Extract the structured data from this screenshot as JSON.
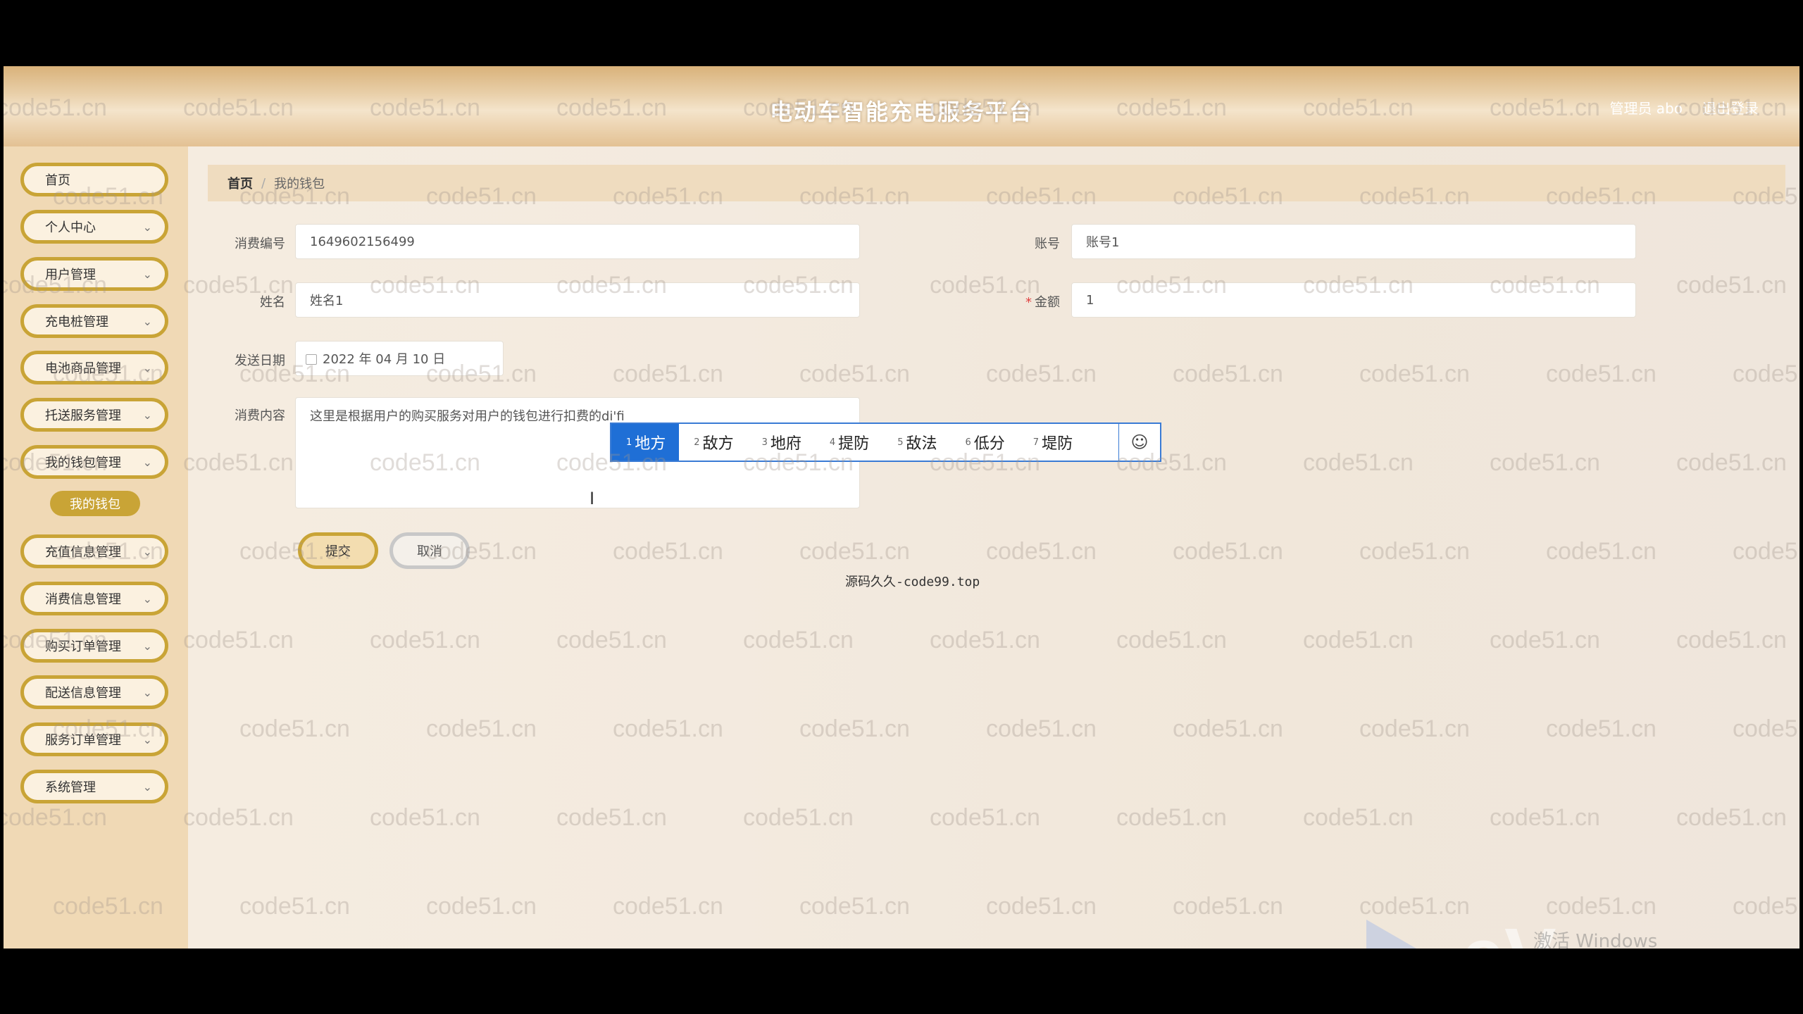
{
  "header": {
    "title": "电动车智能充电服务平台",
    "admin_label": "管理员 abo",
    "logout_label": "退出登录"
  },
  "sidebar": {
    "items": [
      {
        "label": "首页",
        "chevron": false
      },
      {
        "label": "个人中心",
        "chevron": true
      },
      {
        "label": "用户管理",
        "chevron": true
      },
      {
        "label": "充电桩管理",
        "chevron": true
      },
      {
        "label": "电池商品管理",
        "chevron": true
      },
      {
        "label": "托送服务管理",
        "chevron": true
      },
      {
        "label": "我的钱包管理",
        "chevron": true
      },
      {
        "label": "充值信息管理",
        "chevron": true
      },
      {
        "label": "消费信息管理",
        "chevron": true
      },
      {
        "label": "购买订单管理",
        "chevron": true
      },
      {
        "label": "配送信息管理",
        "chevron": true
      },
      {
        "label": "服务订单管理",
        "chevron": true
      },
      {
        "label": "系统管理",
        "chevron": true
      }
    ],
    "sub_item_label": "我的钱包"
  },
  "breadcrumb": {
    "home": "首页",
    "separator": "/",
    "current": "我的钱包"
  },
  "form": {
    "consume_no_label": "消费编号",
    "consume_no_value": "1649602156499",
    "account_label": "账号",
    "account_value": "账号1",
    "name_label": "姓名",
    "name_value": "姓名1",
    "amount_required_mark": "*",
    "amount_label": "金额",
    "amount_value": "1",
    "date_label": "发送日期",
    "date_value": "2022 年 04 月 10 日",
    "content_label": "消费内容",
    "content_value": "这里是根据用户的购买服务对用户的钱包进行扣费的di'fi",
    "submit_label": "提交",
    "cancel_label": "取消"
  },
  "ime": {
    "candidates": [
      {
        "num": "1",
        "text": "地方"
      },
      {
        "num": "2",
        "text": "敌方"
      },
      {
        "num": "3",
        "text": "地府"
      },
      {
        "num": "4",
        "text": "提防"
      },
      {
        "num": "5",
        "text": "敌法"
      },
      {
        "num": "6",
        "text": "低分"
      },
      {
        "num": "7",
        "text": "堤防"
      }
    ],
    "emoji": "☺",
    "tip": "源码久久-code99.top"
  },
  "overlay": {
    "watermark": "code51.cn",
    "windows_activation": "激活 Windows",
    "ev_logo": "eV"
  },
  "colors": {
    "accent_gold": "#c9a436",
    "ime_blue": "#1f6fd6"
  }
}
